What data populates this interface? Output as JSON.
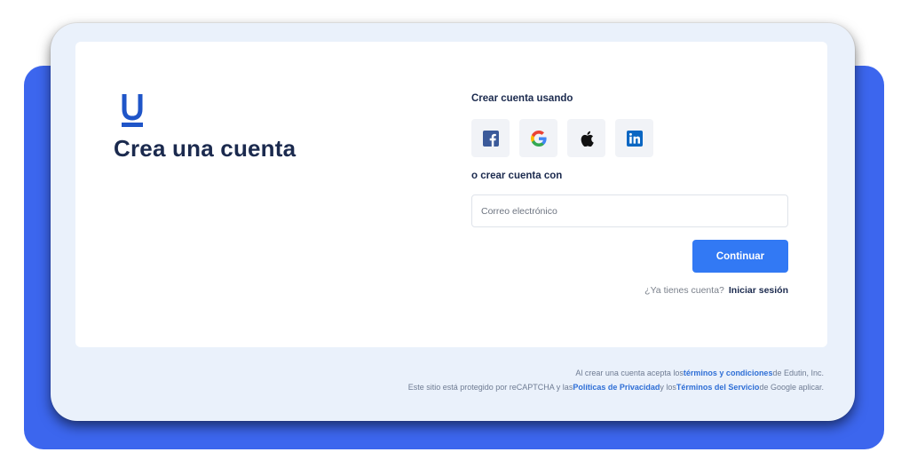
{
  "brand": {
    "logo_icon": "u-logo-icon",
    "accent_color": "#3279f4",
    "backdrop_color": "#3c66ee",
    "heading_color": "#1b2a4e"
  },
  "signup": {
    "title": "Crea una cuenta",
    "create_using_label": "Crear cuenta usando",
    "social_buttons": [
      {
        "provider": "Facebook",
        "icon": "facebook-icon"
      },
      {
        "provider": "Google",
        "icon": "google-icon"
      },
      {
        "provider": "Apple",
        "icon": "apple-icon"
      },
      {
        "provider": "LinkedIn",
        "icon": "linkedin-icon"
      }
    ],
    "or_create_with_label": "o crear cuenta con",
    "email_placeholder": "Correo electrónico",
    "email_value": "",
    "continue_label": "Continuar",
    "have_account_prompt": "¿Ya tienes cuenta?",
    "login_link": "Iniciar sesión"
  },
  "footer": {
    "line1_prefix": "Al crear una cuenta acepta los",
    "terms_link": "términos y condiciones",
    "line1_suffix": "de Edutin, Inc.",
    "line2_prefix": "Este sitio está protegido por reCAPTCHA y las",
    "privacy_link": "Políticas de Privacidad",
    "line2_middle": "y los",
    "service_terms_link": "Términos del Servicio",
    "line2_suffix": "de Google aplicar."
  }
}
